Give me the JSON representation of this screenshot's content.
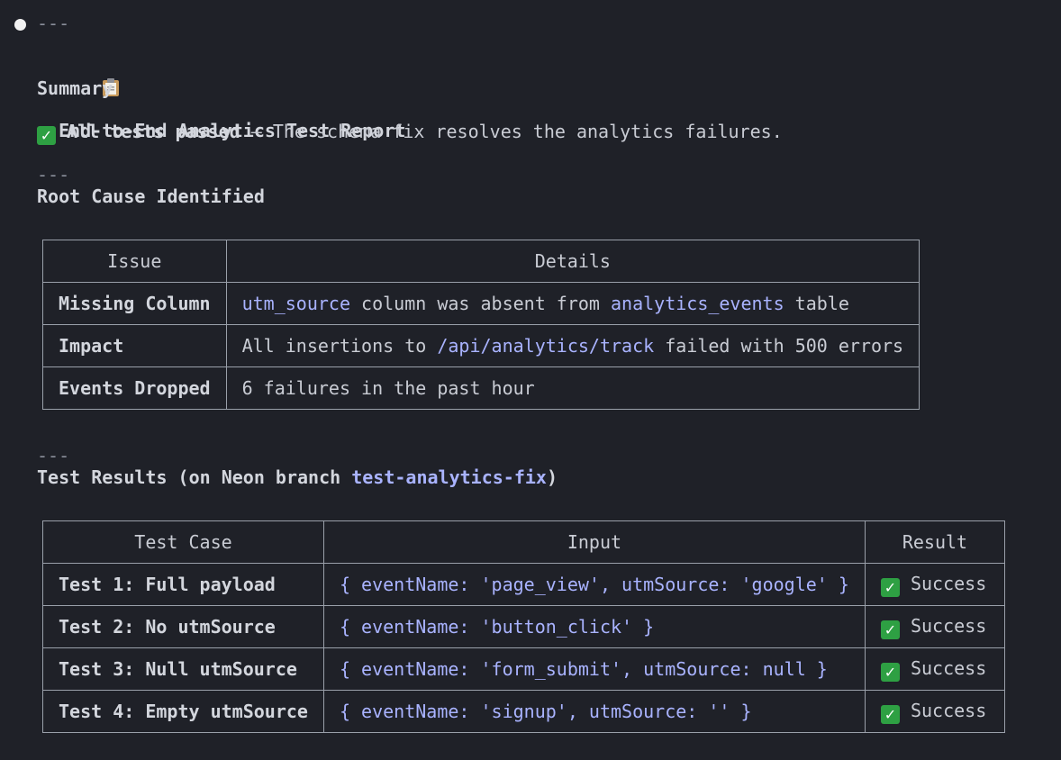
{
  "report": {
    "rule_top": "---",
    "title": "End-to-End Analytics Test Report",
    "summary_heading": "Summary",
    "summary_status": "All tests passed",
    "summary_rest": " – The schema fix resolves the analytics failures.",
    "rule_2": "---",
    "root_cause_heading": "Root Cause Identified",
    "rule_3": "---",
    "test_results_prefix": "Test Results (on Neon branch ",
    "test_results_branch": "test-analytics-fix",
    "test_results_suffix": ")"
  },
  "root_cause_table": {
    "headers": [
      "Issue",
      "Details"
    ],
    "rows": [
      {
        "issue": "Missing Column",
        "code1": "utm_source",
        "mid": " column was absent from ",
        "code2": "analytics_events",
        "end": " table"
      },
      {
        "issue": "Impact",
        "pre": "All insertions to ",
        "code": "/api/analytics/track",
        "end": " failed with 500 errors"
      },
      {
        "issue": "Events Dropped",
        "text": "6 failures in the past hour"
      }
    ]
  },
  "test_table": {
    "headers": [
      "Test Case",
      "Input",
      "Result"
    ],
    "rows": [
      {
        "case": "Test 1: Full payload",
        "input": "{ eventName: 'page_view', utmSource: 'google' }",
        "result": "Success"
      },
      {
        "case": "Test 2: No utmSource",
        "input": "{ eventName: 'button_click' }",
        "result": "Success"
      },
      {
        "case": "Test 3: Null utmSource",
        "input": "{ eventName: 'form_submit', utmSource: null }",
        "result": "Success"
      },
      {
        "case": "Test 4: Empty utmSource",
        "input": "{ eventName: 'signup', utmSource: '' }",
        "result": "Success"
      }
    ]
  },
  "icons": {
    "clipboard": "clipboard-icon",
    "check": "check-mark-icon",
    "check_color": "#2ea043"
  }
}
